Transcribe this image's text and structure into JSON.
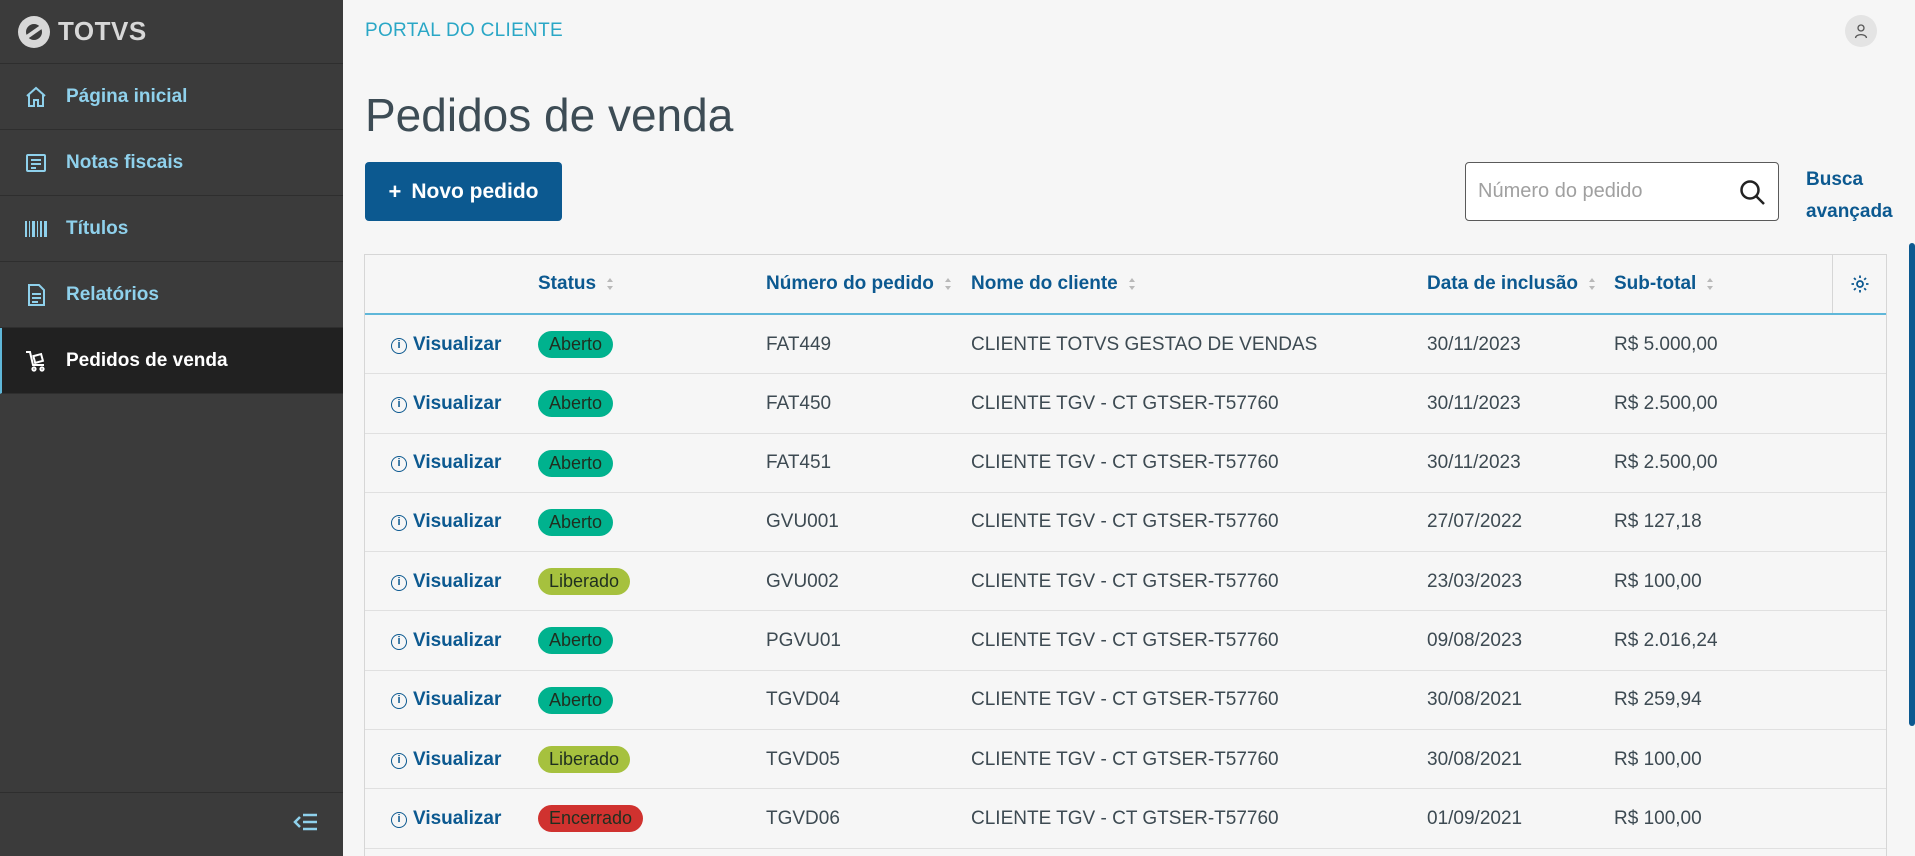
{
  "sidebar": {
    "brand": "TOTVS",
    "items": [
      {
        "label": "Página inicial",
        "icon": "home-icon"
      },
      {
        "label": "Notas fiscais",
        "icon": "receipt-icon"
      },
      {
        "label": "Títulos",
        "icon": "barcode-icon"
      },
      {
        "label": "Relatórios",
        "icon": "document-icon"
      },
      {
        "label": "Pedidos de venda",
        "icon": "cart-icon",
        "active": true
      }
    ],
    "collapse_icon": "collapse-menu-icon"
  },
  "header": {
    "portal_title": "PORTAL DO CLIENTE",
    "user_icon": "user-icon"
  },
  "page": {
    "title": "Pedidos de venda",
    "new_button_plus": "+",
    "new_button": "Novo pedido",
    "search_placeholder": "Número do pedido",
    "search_value": "",
    "advanced_search_line1": "Busca",
    "advanced_search_line2": "avançada"
  },
  "table": {
    "columns": {
      "status": "Status",
      "number": "Número do pedido",
      "client": "Nome do cliente",
      "date": "Data de inclusão",
      "subtotal": "Sub-total"
    },
    "view_label": "Visualizar",
    "status_colors": {
      "Aberto": "#00b28e",
      "Liberado": "#a6c13e",
      "Encerrado": "#d0322f"
    },
    "rows": [
      {
        "status": "Aberto",
        "number": "FAT449",
        "client": "CLIENTE TOTVS GESTAO DE VENDAS",
        "date": "30/11/2023",
        "subtotal": "R$ 5.000,00"
      },
      {
        "status": "Aberto",
        "number": "FAT450",
        "client": "CLIENTE TGV - CT GTSER-T57760",
        "date": "30/11/2023",
        "subtotal": "R$ 2.500,00"
      },
      {
        "status": "Aberto",
        "number": "FAT451",
        "client": "CLIENTE TGV - CT GTSER-T57760",
        "date": "30/11/2023",
        "subtotal": "R$ 2.500,00"
      },
      {
        "status": "Aberto",
        "number": "GVU001",
        "client": "CLIENTE TGV - CT GTSER-T57760",
        "date": "27/07/2022",
        "subtotal": "R$ 127,18"
      },
      {
        "status": "Liberado",
        "number": "GVU002",
        "client": "CLIENTE TGV - CT GTSER-T57760",
        "date": "23/03/2023",
        "subtotal": "R$ 100,00"
      },
      {
        "status": "Aberto",
        "number": "PGVU01",
        "client": "CLIENTE TGV - CT GTSER-T57760",
        "date": "09/08/2023",
        "subtotal": "R$ 2.016,24"
      },
      {
        "status": "Aberto",
        "number": "TGVD04",
        "client": "CLIENTE TGV - CT GTSER-T57760",
        "date": "30/08/2021",
        "subtotal": "R$ 259,94"
      },
      {
        "status": "Liberado",
        "number": "TGVD05",
        "client": "CLIENTE TGV - CT GTSER-T57760",
        "date": "30/08/2021",
        "subtotal": "R$ 100,00"
      },
      {
        "status": "Encerrado",
        "number": "TGVD06",
        "client": "CLIENTE TGV - CT GTSER-T57760",
        "date": "01/09/2021",
        "subtotal": "R$ 100,00"
      }
    ]
  }
}
